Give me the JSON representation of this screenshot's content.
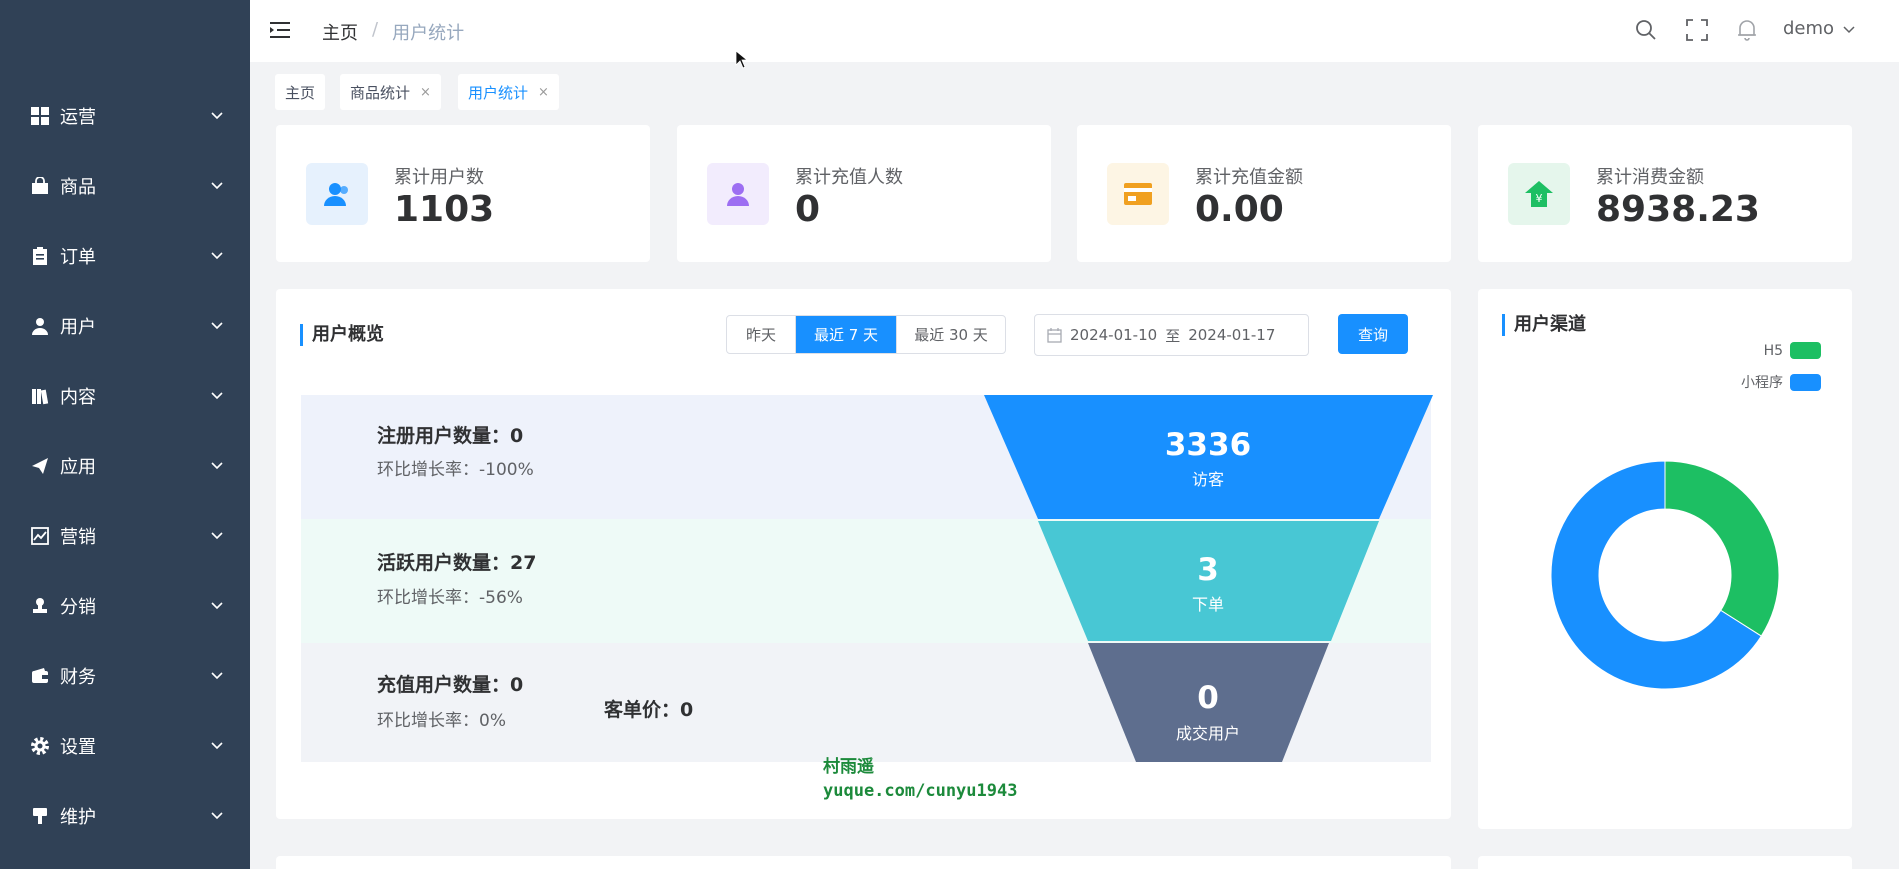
{
  "sidebar": {
    "items": [
      {
        "label": "运营",
        "icon": "dashboard-grid-icon"
      },
      {
        "label": "商品",
        "icon": "shopping-bag-icon"
      },
      {
        "label": "订单",
        "icon": "clipboard-icon"
      },
      {
        "label": "用户",
        "icon": "user-icon"
      },
      {
        "label": "内容",
        "icon": "book-icon"
      },
      {
        "label": "应用",
        "icon": "paper-plane-icon"
      },
      {
        "label": "营销",
        "icon": "trend-chart-icon"
      },
      {
        "label": "分销",
        "icon": "stamp-icon"
      },
      {
        "label": "财务",
        "icon": "wallet-icon"
      },
      {
        "label": "设置",
        "icon": "gear-icon"
      },
      {
        "label": "维护",
        "icon": "tool-icon"
      }
    ]
  },
  "header": {
    "breadcrumb": {
      "home": "主页",
      "separator": "/",
      "current": "用户统计"
    },
    "user": "demo"
  },
  "tags": [
    {
      "label": "主页"
    },
    {
      "label": "商品统计",
      "close": "×"
    },
    {
      "label": "用户统计",
      "close": "×"
    }
  ],
  "stats": [
    {
      "label": "累计用户数",
      "value": "1103",
      "icon": "users-icon"
    },
    {
      "label": "累计充值人数",
      "value": "0",
      "icon": "person-icon"
    },
    {
      "label": "累计充值金额",
      "value": "0.00",
      "icon": "card-icon"
    },
    {
      "label": "累计消费金额",
      "value": "8938.23",
      "icon": "yen-house-icon"
    }
  ],
  "overview": {
    "title": "用户概览",
    "ranges": [
      "昨天",
      "最近 7 天",
      "最近 30 天"
    ],
    "active_range": "最近 7 天",
    "date_start": "2024-01-10",
    "date_to": "至",
    "date_end": "2024-01-17",
    "query_label": "查询",
    "rows": [
      {
        "title": "注册用户数量：0",
        "sub": "环比增长率：-100%"
      },
      {
        "title": "活跃用户数量：27",
        "sub": "环比增长率：-56%"
      },
      {
        "title": "充值用户数量：0",
        "sub": "环比增长率：0%",
        "extra": "客单价：0"
      }
    ],
    "funnel": [
      {
        "value": "3336",
        "label": "访客"
      },
      {
        "value": "3",
        "label": "下单"
      },
      {
        "value": "0",
        "label": "成交用户"
      }
    ]
  },
  "channel": {
    "title": "用户渠道",
    "legend": [
      {
        "name": "H5",
        "color": "#1dbf63"
      },
      {
        "name": "小程序",
        "color": "#1890ff"
      }
    ]
  },
  "chart_data": {
    "type": "pie",
    "donut": true,
    "series": [
      {
        "name": "H5",
        "value": 34,
        "color": "#1dbf63"
      },
      {
        "name": "小程序",
        "value": 66,
        "color": "#1890ff"
      }
    ],
    "legend": "top-right"
  },
  "watermark": {
    "line1": "村雨遥",
    "line2": "yuque.com/cunyu1943"
  }
}
